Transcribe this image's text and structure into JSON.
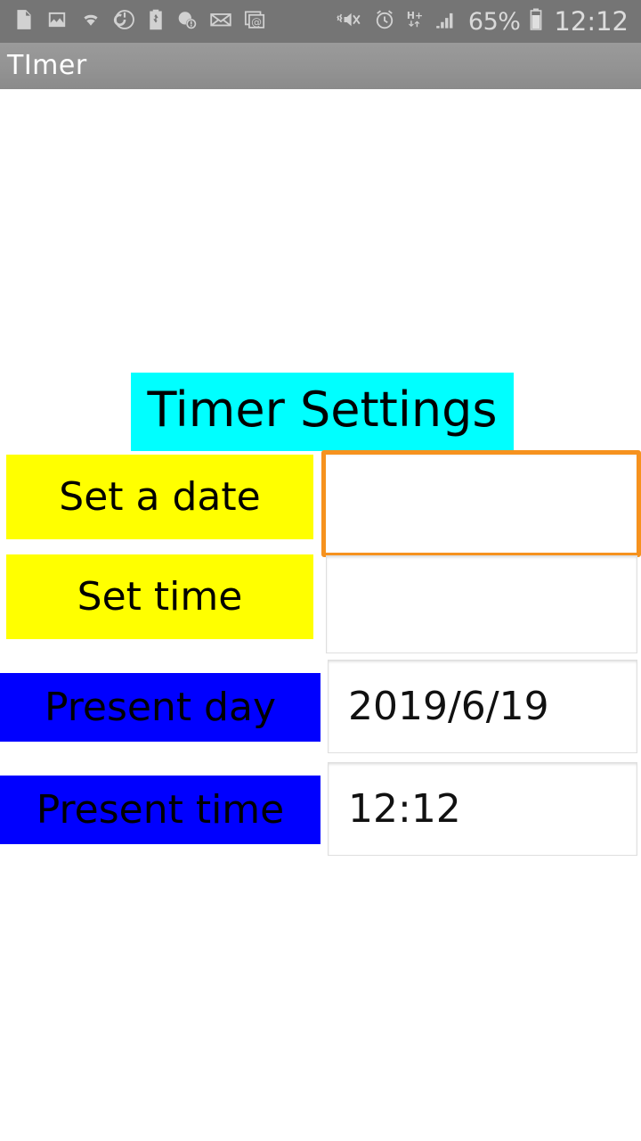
{
  "status_bar": {
    "background_color": "#757575",
    "left_icons": [
      {
        "name": "screenshot-icon",
        "label": "screenshot"
      },
      {
        "name": "image-icon",
        "label": "image"
      },
      {
        "name": "wifi-icon",
        "label": "wifi"
      },
      {
        "name": "power-saving-icon",
        "label": "power-saving"
      },
      {
        "name": "battery-saver-icon",
        "label": "battery-saver"
      },
      {
        "name": "storage-warning-icon",
        "label": "storage-warning"
      },
      {
        "name": "mail-icon",
        "label": "mail"
      },
      {
        "name": "email-at-icon",
        "label": "email-at"
      }
    ],
    "right_icons": [
      {
        "name": "mute-vibrate-icon",
        "label": "mute"
      },
      {
        "name": "alarm-icon",
        "label": "alarm"
      },
      {
        "name": "hsdpa-data-icon",
        "label": "H+"
      },
      {
        "name": "signal-bars-icon",
        "label": "signal"
      },
      {
        "name": "battery-icon",
        "label": "battery"
      }
    ],
    "battery_percent": "65%",
    "data_label": "H+",
    "clock": "12:12"
  },
  "title_bar": {
    "title": "TImer",
    "background_color": "#919191",
    "text_color": "#ffffff"
  },
  "main": {
    "heading": {
      "text": "Timer Settings",
      "background_color": "#00FFFF",
      "text_color": "#000000"
    },
    "rows": [
      {
        "label": "Set a date",
        "label_color": "#FFFF00",
        "value": "",
        "field_state": "focused",
        "field_border_color": "#F6921E"
      },
      {
        "label": "Set time",
        "label_color": "#FFFF00",
        "value": "",
        "field_state": "normal",
        "field_border_color": "#dfdfdf"
      },
      {
        "label": "Present day",
        "label_color": "#0000FF",
        "value": "2019/6/19",
        "field_state": "normal",
        "field_border_color": "#dfdfdf"
      },
      {
        "label": "Present time",
        "label_color": "#0000FF",
        "value": "12:12",
        "field_state": "normal",
        "field_border_color": "#dfdfdf"
      }
    ]
  }
}
